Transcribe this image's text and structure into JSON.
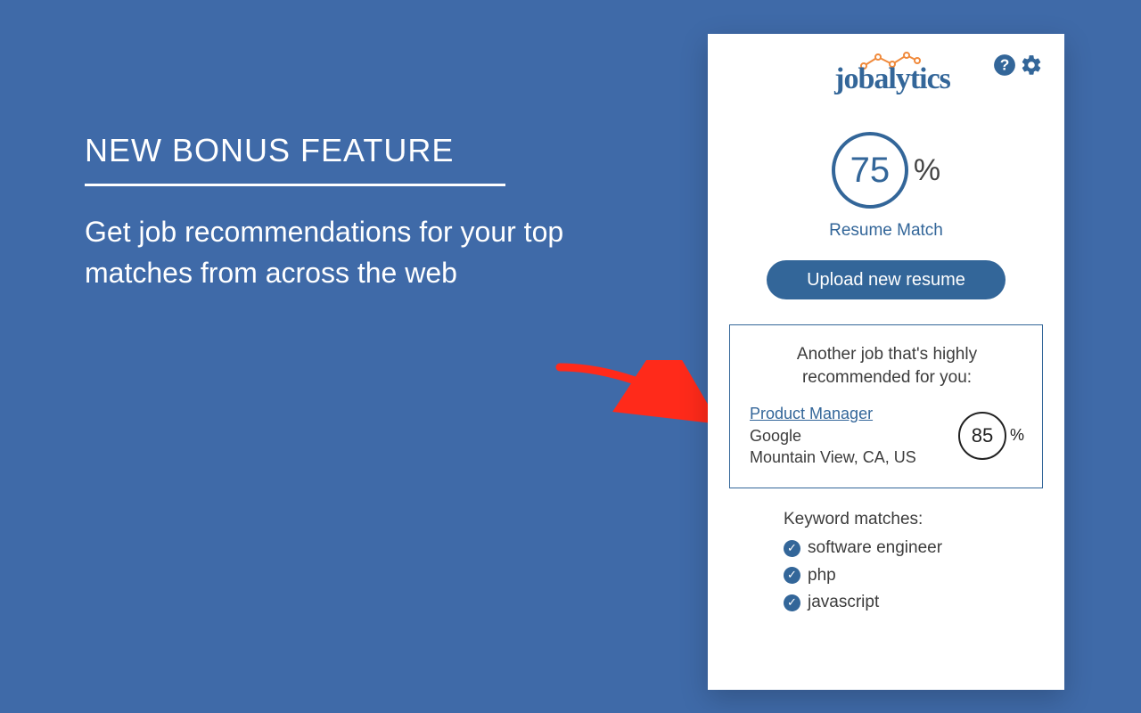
{
  "promo": {
    "heading": "NEW BONUS FEATURE",
    "subtext": "Get job recommendations for your top matches from across the web"
  },
  "panel": {
    "brand": "jobalytics",
    "match": {
      "score": "75",
      "pct_symbol": "%",
      "label": "Resume Match"
    },
    "upload_button": "Upload new resume",
    "recommendation": {
      "heading": "Another job that's highly recommended for you:",
      "job_title": "Product Manager",
      "company": "Google",
      "location": "Mountain View, CA, US",
      "score": "85",
      "pct_symbol": "%"
    },
    "keywords": {
      "heading": "Keyword matches:",
      "items": [
        "software engineer",
        "php",
        "javascript"
      ]
    }
  },
  "colors": {
    "bg": "#3f6aa8",
    "brand_blue": "#336699",
    "arrow": "#ff2a1a"
  }
}
